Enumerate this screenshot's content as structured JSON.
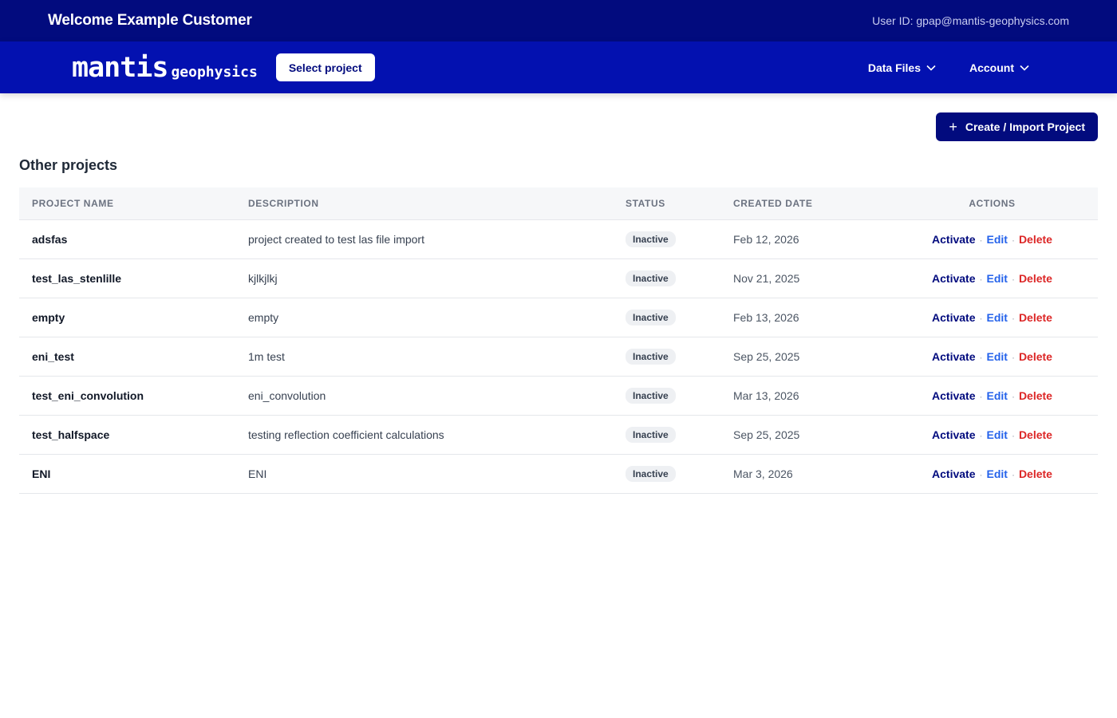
{
  "header": {
    "welcome": "Welcome Example Customer",
    "user_id": "User ID: gpap@mantis-geophysics.com"
  },
  "nav": {
    "logo_main": "mantis",
    "logo_sub": "geophysics",
    "select_project": "Select project",
    "data_files": "Data Files",
    "account": "Account"
  },
  "main": {
    "create_button": "Create / Import Project",
    "section_title": "Other projects",
    "columns": [
      "PROJECT NAME",
      "DESCRIPTION",
      "STATUS",
      "CREATED DATE",
      "ACTIONS"
    ],
    "actions": {
      "activate": "Activate",
      "edit": "Edit",
      "delete": "Delete",
      "separator": "·"
    },
    "rows": [
      {
        "name": "adsfas",
        "description": "project created to test las file import",
        "status": "Inactive",
        "created": "Feb 12, 2026"
      },
      {
        "name": "test_las_stenlille",
        "description": "kjlkjlkj",
        "status": "Inactive",
        "created": "Nov 21, 2025"
      },
      {
        "name": "empty",
        "description": "empty",
        "status": "Inactive",
        "created": "Feb 13, 2026"
      },
      {
        "name": "eni_test",
        "description": "1m test",
        "status": "Inactive",
        "created": "Sep 25, 2025"
      },
      {
        "name": "test_eni_convolution",
        "description": "eni_convolution",
        "status": "Inactive",
        "created": "Mar 13, 2026"
      },
      {
        "name": "test_halfspace",
        "description": "testing reflection coefficient calculations",
        "status": "Inactive",
        "created": "Sep 25, 2025"
      },
      {
        "name": "ENI",
        "description": "ENI",
        "status": "Inactive",
        "created": "Mar 3, 2026"
      }
    ]
  },
  "colors": {
    "topbar": "#020b7e",
    "navbar": "#0311b0",
    "activate": "#020b7e",
    "edit": "#2563eb",
    "delete": "#dc2626"
  }
}
